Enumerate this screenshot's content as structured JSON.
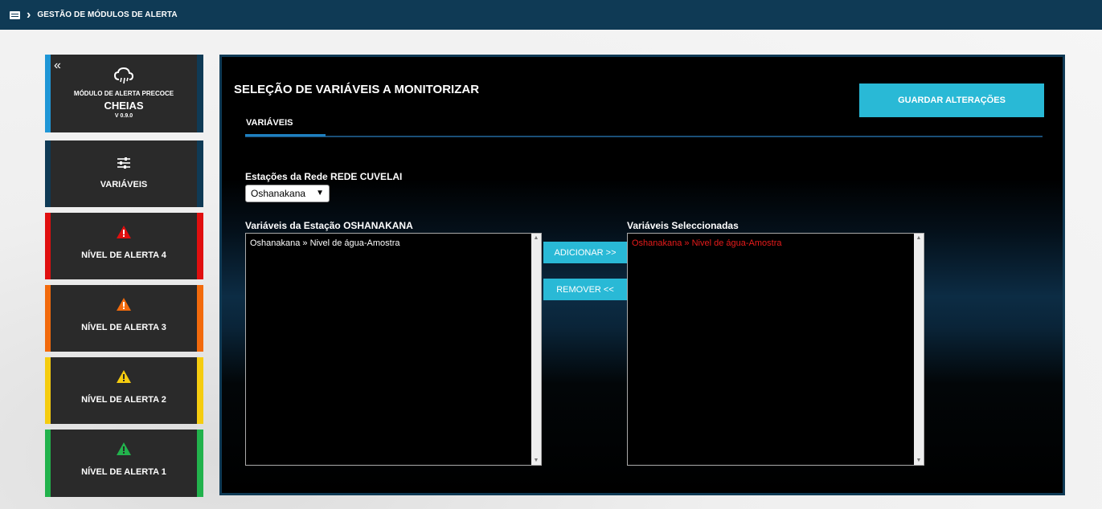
{
  "topbar": {
    "breadcrumb": "GESTÃO DE MÓDULOS DE ALERTA"
  },
  "sidebar": {
    "module": {
      "subtitle": "MÓDULO DE ALERTA PRECOCE",
      "name": "CHEIAS",
      "version": "V 0.9.0"
    },
    "variables_label": "VARIÁVEIS",
    "alerts": [
      {
        "label": "NÍVEL DE ALERTA 4",
        "color": "#e00f0f"
      },
      {
        "label": "NÍVEL DE ALERTA 3",
        "color": "#f26a0c"
      },
      {
        "label": "NÍVEL DE ALERTA 2",
        "color": "#f5cc0f"
      },
      {
        "label": "NÍVEL DE ALERTA 1",
        "color": "#22b24c"
      }
    ]
  },
  "main": {
    "title": "SELEÇÃO DE VARIÁVEIS A MONITORIZAR",
    "tab": "VARIÁVEIS",
    "save_label": "GUARDAR ALTERAÇÕES",
    "network_label": "Estações da Rede  REDE CUVELAI",
    "station_selected": "Oshanakana",
    "station_vars_label": "Variáveis da Estação  OSHANAKANA",
    "station_vars": [
      "Oshanakana » Nivel de água-Amostra"
    ],
    "add_label": "ADICIONAR >>",
    "remove_label": "REMOVER  <<",
    "selected_vars_label": "Variáveis Seleccionadas",
    "selected_vars": [
      "Oshanakana » Nivel de água-Amostra"
    ]
  },
  "colors": {
    "accent": "#29b9d6",
    "navy": "#0f3a55",
    "selected_text": "#e81b1b"
  }
}
